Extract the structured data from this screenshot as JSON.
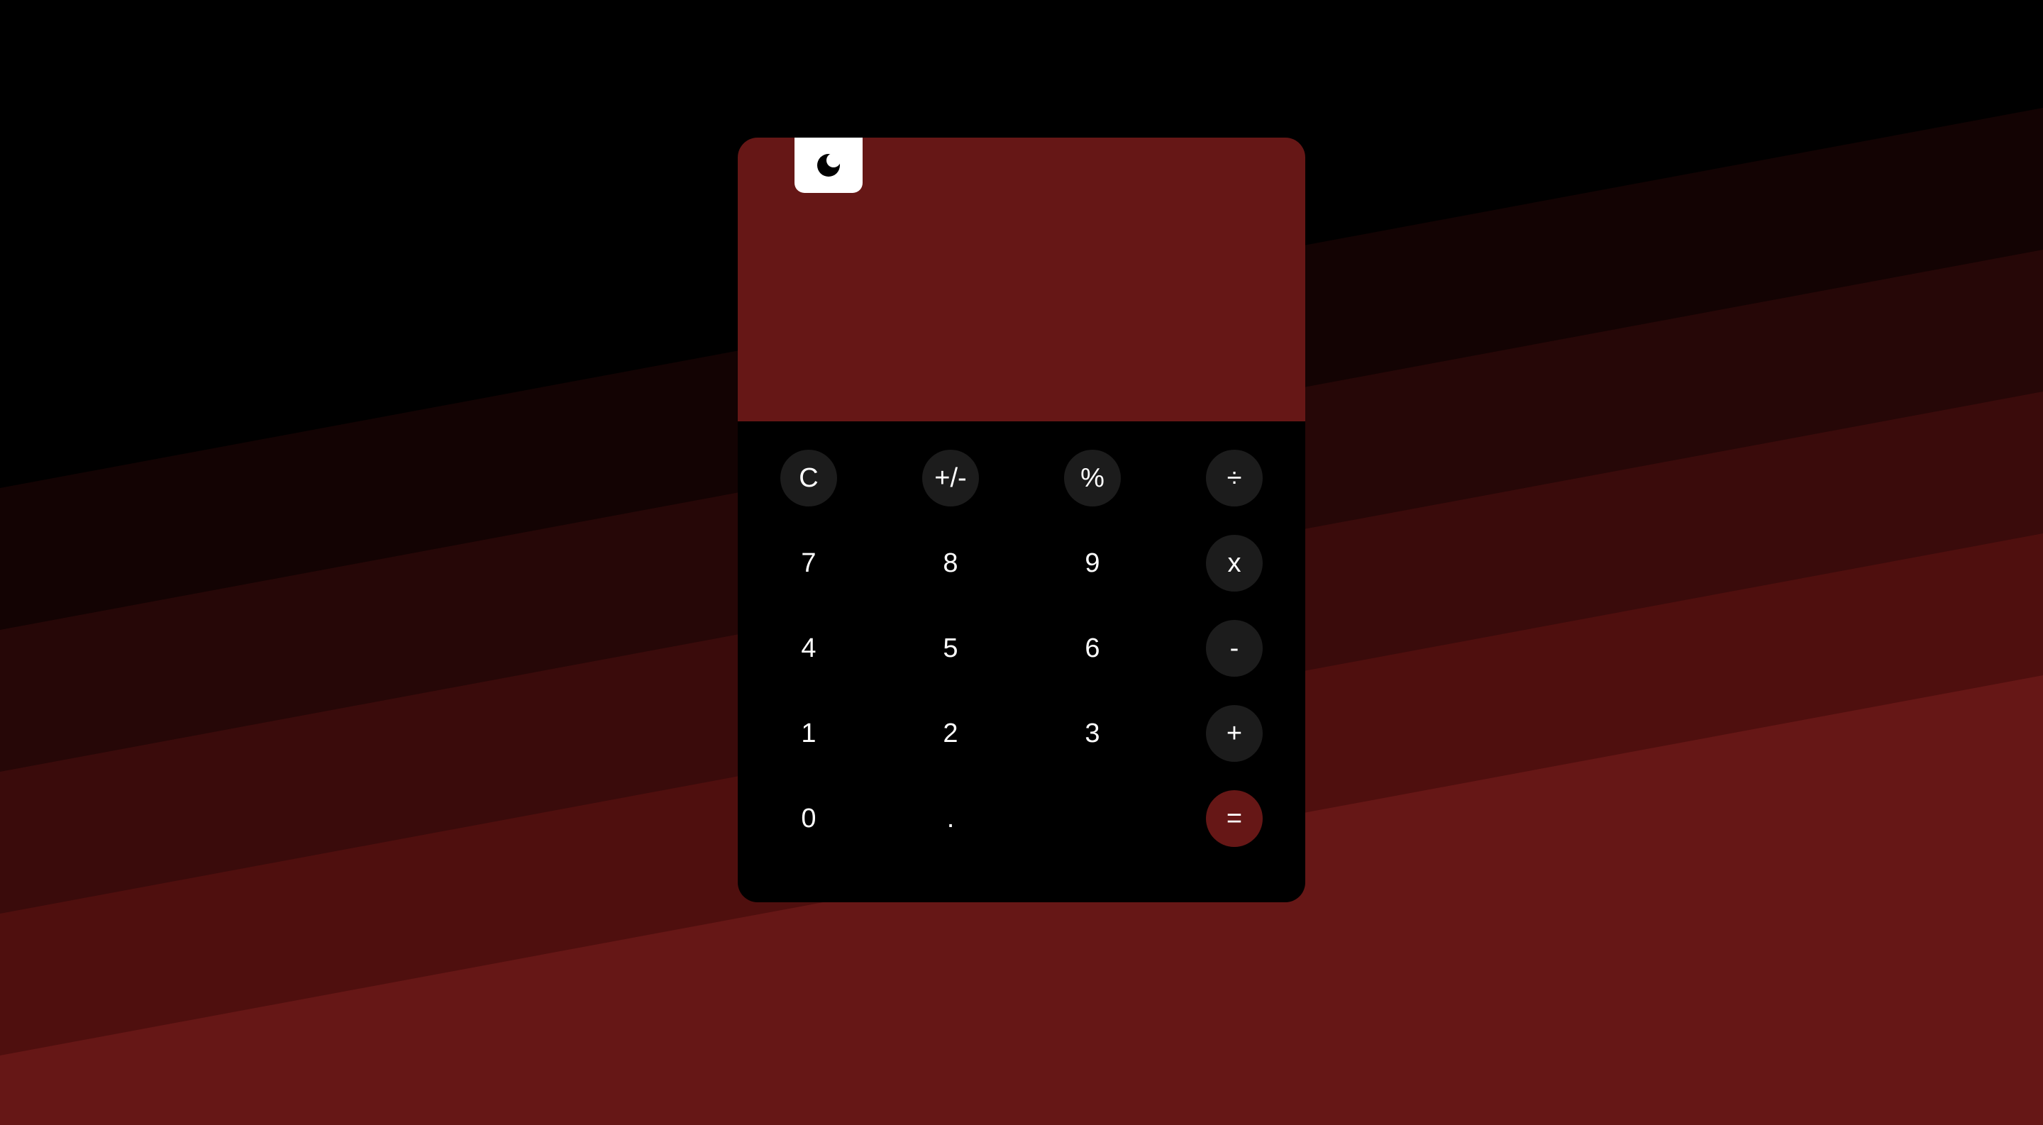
{
  "colors": {
    "background_top": "#000000",
    "stripe_1": "#130303",
    "stripe_2": "#260707",
    "stripe_3": "#3a0b0b",
    "stripe_4": "#4f0f0e",
    "stripe_5": "#661716",
    "display_bg": "#661716",
    "keypad_bg": "#000000",
    "function_key_bg": "#1c1c1c",
    "equals_key_bg": "#661716",
    "key_text": "#ffffff",
    "toggle_bg": "#ffffff"
  },
  "display": {
    "value": ""
  },
  "theme_toggle": {
    "icon": "moon-icon"
  },
  "keys": {
    "clear": "C",
    "sign": "+/-",
    "percent": "%",
    "divide": "÷",
    "seven": "7",
    "eight": "8",
    "nine": "9",
    "multiply": "x",
    "four": "4",
    "five": "5",
    "six": "6",
    "subtract": "-",
    "one": "1",
    "two": "2",
    "three": "3",
    "add": "+",
    "zero": "0",
    "decimal": ".",
    "equals": "="
  }
}
